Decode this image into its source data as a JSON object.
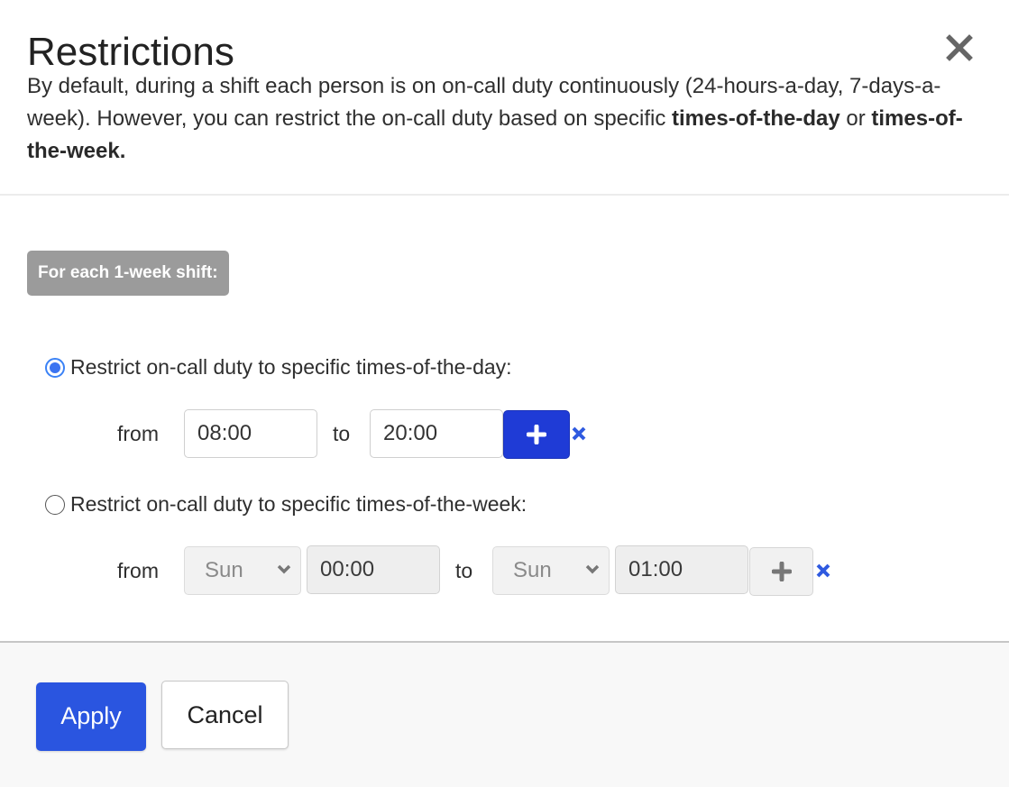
{
  "dialog": {
    "title": "Restrictions",
    "close_icon": "close-icon",
    "description": {
      "text_1": "By default, during a shift each person is on on-call duty continuously (24-hours-a-day, 7-days-a-week). However, you can restrict the on-call duty based on specific ",
      "bold_1": "times-of-the-day",
      "text_2": " or ",
      "bold_2": "times-of-the-week."
    }
  },
  "shift_badge": "For each 1-week shift:",
  "options": [
    {
      "label": "Restrict on-call duty to specific times-of-the-day:",
      "selected": true,
      "from_label": "from",
      "to_label": "to",
      "from_time": "08:00",
      "to_time": "20:00",
      "add_icon": "plus-icon",
      "remove_icon": "close-icon"
    },
    {
      "label": "Restrict on-call duty to specific times-of-the-week:",
      "selected": false,
      "from_label": "from",
      "to_label": "to",
      "from_day": "Sun",
      "from_time": "00:00",
      "to_day": "Sun",
      "to_time": "01:00",
      "add_icon": "plus-icon",
      "remove_icon": "close-icon"
    }
  ],
  "footer": {
    "apply_label": "Apply",
    "cancel_label": "Cancel"
  },
  "colors": {
    "primary": "#2a55e0",
    "add_button": "#1f3bd6",
    "radio_selected": "#3b74f1",
    "badge_bg": "#9b9b9b"
  }
}
